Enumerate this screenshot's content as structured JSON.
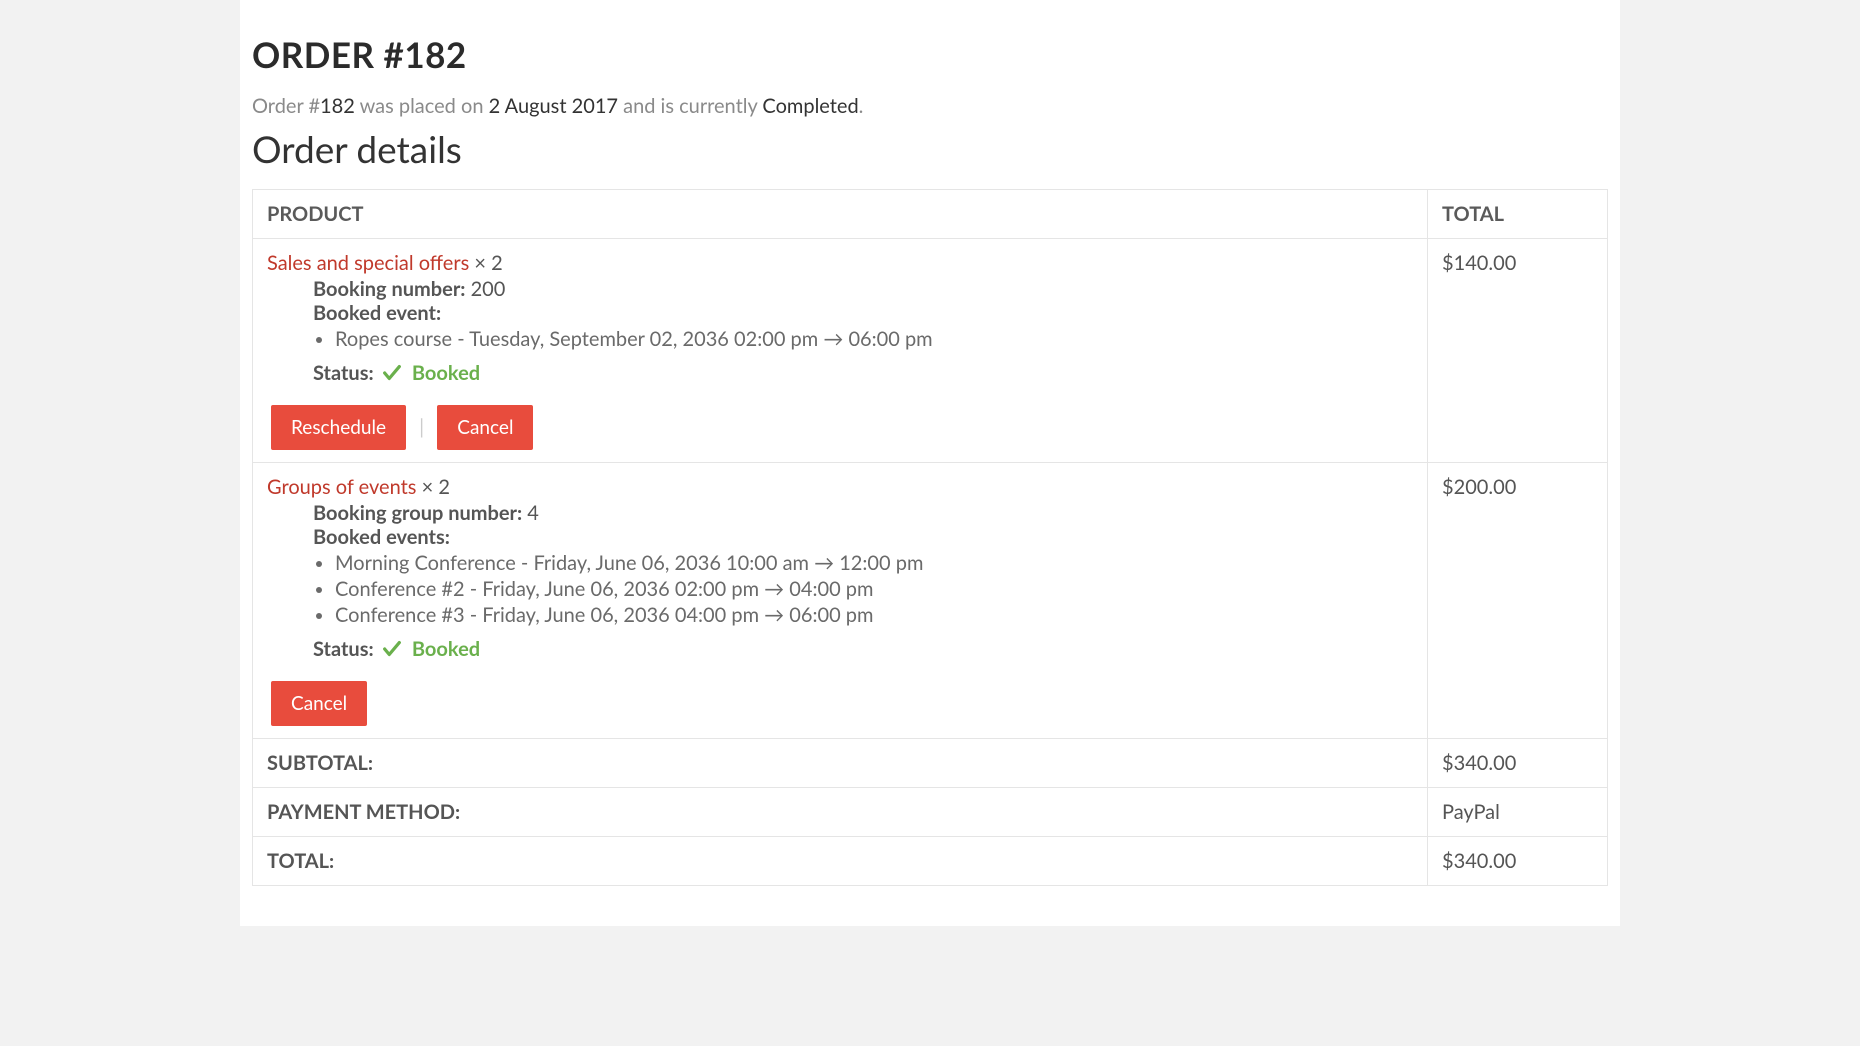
{
  "header": {
    "title": "ORDER #182",
    "summary_prefix": "Order #",
    "order_number": "182",
    "summary_mid1": " was placed on ",
    "order_date": "2 August 2017",
    "summary_mid2": " and is currently ",
    "order_status": "Completed",
    "summary_suffix": "."
  },
  "section_heading": "Order details",
  "columns": {
    "product": "PRODUCT",
    "total": "TOTAL"
  },
  "labels": {
    "booking_number": "Booking number:",
    "booked_event": "Booked event:",
    "booking_group_number": "Booking group number:",
    "booked_events": "Booked events:",
    "status": "Status:",
    "booked": "Booked",
    "reschedule": "Reschedule",
    "cancel": "Cancel",
    "subtotal": "SUBTOTAL:",
    "payment_method": "PAYMENT METHOD:",
    "total": "TOTAL:"
  },
  "items": [
    {
      "product_name": "Sales and special offers",
      "qty_text": " × 2",
      "booking_number": "200",
      "events": [
        "Ropes course - Tuesday, September 02, 2036 02:00 pm → 06:00 pm"
      ],
      "amount": "$140.00",
      "show_reschedule": true
    },
    {
      "product_name": "Groups of events",
      "qty_text": " × 2",
      "booking_group_number": "4",
      "events": [
        "Morning Conference - Friday, June 06, 2036 10:00 am → 12:00 pm",
        "Conference #2 - Friday, June 06, 2036 02:00 pm → 04:00 pm",
        "Conference #3 - Friday, June 06, 2036 04:00 pm → 06:00 pm"
      ],
      "amount": "$200.00",
      "show_reschedule": false
    }
  ],
  "totals": {
    "subtotal": "$340.00",
    "payment_method": "PayPal",
    "total": "$340.00"
  }
}
